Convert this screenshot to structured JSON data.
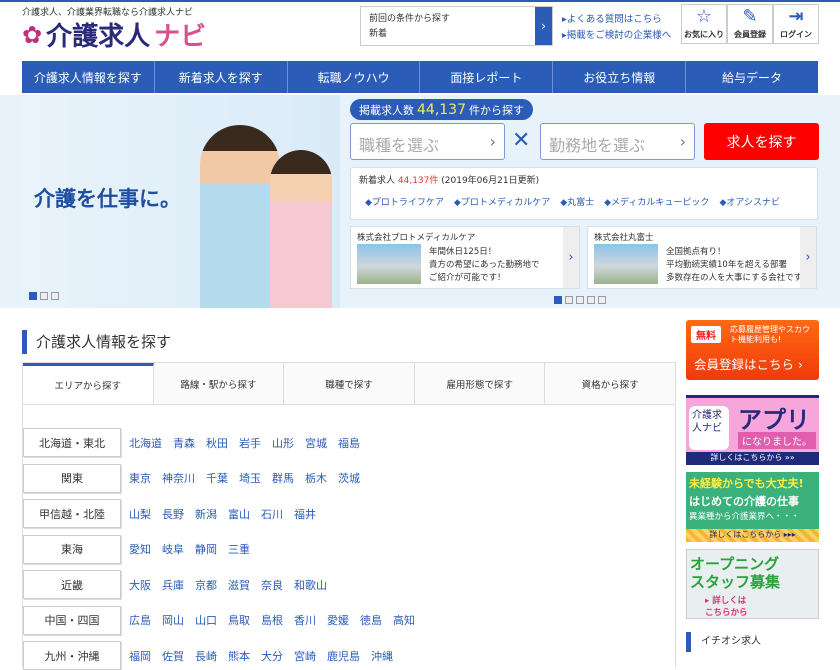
{
  "header": {
    "tagline": "介護求人、介護業界転職なら介護求人ナビ",
    "logo_main": "介護求人",
    "logo_accent": "ナビ",
    "prev_search": {
      "title": "前回の条件から探す",
      "value": "新着"
    },
    "links": [
      "▸よくある質問はこちら",
      "▸掲載をご検討の企業様へ"
    ],
    "buttons": [
      {
        "label": "お気に入り",
        "icon": "star-icon"
      },
      {
        "label": "会員登録",
        "icon": "edit-icon"
      },
      {
        "label": "ログイン",
        "icon": "login-icon"
      }
    ]
  },
  "nav": [
    "介護求人情報を探す",
    "新着求人を探す",
    "転職ノウハウ",
    "面接レポート",
    "お役立ち情報",
    "給与データ"
  ],
  "hero": {
    "slogan": "介護を仕事に。",
    "count_prefix": "掲載求人数",
    "count": "44,137",
    "count_suffix": "件から探す",
    "job_type_placeholder": "職種を選ぶ",
    "location_placeholder": "勤務地を選ぶ",
    "search_button": "求人を探す",
    "new_prefix": "新着求人",
    "new_count": "44,137件",
    "new_date": "(2019年06月21日更新)",
    "companies": [
      "◆プロトライフケア",
      "◆プロトメディカルケア",
      "◆丸富士",
      "◆メディカルキューピック",
      "◆オアシスナビ"
    ],
    "cards": [
      {
        "name": "株式会社プロトメディカルケア",
        "lines": [
          "年間休日125日！",
          "貴方の希望にあった勤務地で",
          "ご紹介が可能です！"
        ]
      },
      {
        "name": "株式会社丸富士",
        "lines": [
          "全国拠点有り！",
          "平均勤続実績10年を超える部署",
          "多数存在の人を大事にする会社です"
        ]
      }
    ]
  },
  "main": {
    "title": "介護求人情報を探す",
    "tabs": [
      "エリアから探す",
      "路線・駅から探す",
      "職種で探す",
      "雇用形態で探す",
      "資格から探す"
    ],
    "regions": [
      {
        "name": "北海道・東北",
        "prefs": [
          "北海道",
          "青森",
          "秋田",
          "岩手",
          "山形",
          "宮城",
          "福島"
        ]
      },
      {
        "name": "関東",
        "prefs": [
          "東京",
          "神奈川",
          "千葉",
          "埼玉",
          "群馬",
          "栃木",
          "茨城"
        ]
      },
      {
        "name": "甲信越・北陸",
        "prefs": [
          "山梨",
          "長野",
          "新潟",
          "富山",
          "石川",
          "福井"
        ]
      },
      {
        "name": "東海",
        "prefs": [
          "愛知",
          "岐阜",
          "静岡",
          "三重"
        ]
      },
      {
        "name": "近畿",
        "prefs": [
          "大阪",
          "兵庫",
          "京都",
          "滋賀",
          "奈良",
          "和歌山"
        ]
      },
      {
        "name": "中国・四国",
        "prefs": [
          "広島",
          "岡山",
          "山口",
          "鳥取",
          "島根",
          "香川",
          "愛媛",
          "徳島",
          "高知"
        ]
      },
      {
        "name": "九州・沖縄",
        "prefs": [
          "福岡",
          "佐賀",
          "長崎",
          "熊本",
          "大分",
          "宮崎",
          "鹿児島",
          "沖縄"
        ]
      }
    ]
  },
  "sidebar": {
    "reg_free": "無料",
    "reg_sub": "応募履歴管理やスカウト機能利用も!",
    "reg_main": "会員登録はこちら ›",
    "app": {
      "logo": "介護求人ナビ",
      "title": "アプリ",
      "sub": "になりました。",
      "more": "詳しくはこちらから »»"
    },
    "inexp": {
      "l1": "未経験からでも大丈夫!",
      "l2": "はじめての介護の仕事",
      "l3": "異業種から介護業界へ・・・",
      "more": "詳しくはこちらから ▸▸▸"
    },
    "opening": {
      "l1": "オープニング",
      "l2": "スタッフ募集",
      "more": "▸ 詳しくは こちらから"
    },
    "pick": "イチオシ求人"
  }
}
